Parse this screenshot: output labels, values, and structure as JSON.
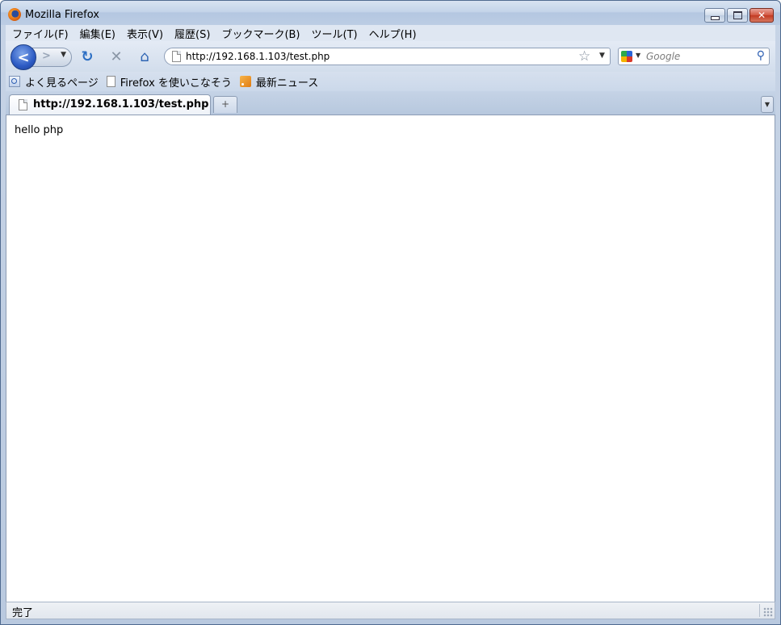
{
  "window": {
    "title": "Mozilla Firefox"
  },
  "menubar": {
    "items": [
      "ファイル(F)",
      "編集(E)",
      "表示(V)",
      "履歴(S)",
      "ブックマーク(B)",
      "ツール(T)",
      "ヘルプ(H)"
    ]
  },
  "navigation": {
    "url": "http://192.168.1.103/test.php",
    "search_placeholder": "Google"
  },
  "bookmarks": {
    "items": [
      "よく見るページ",
      "Firefox を使いこなそう",
      "最新ニュース"
    ]
  },
  "tabs": [
    {
      "label": "http://192.168.1.103/test.php",
      "active": true
    }
  ],
  "content": {
    "text": "hello php"
  },
  "statusbar": {
    "text": "完了"
  },
  "icons": {
    "app": "firefox-icon",
    "back": "back-arrow-icon",
    "forward": "forward-arrow-icon",
    "reload": "reload-icon",
    "stop": "stop-icon",
    "home": "home-icon",
    "bookmark_star": "star-icon",
    "search_engine": "google-icon",
    "search": "magnifier-icon"
  }
}
